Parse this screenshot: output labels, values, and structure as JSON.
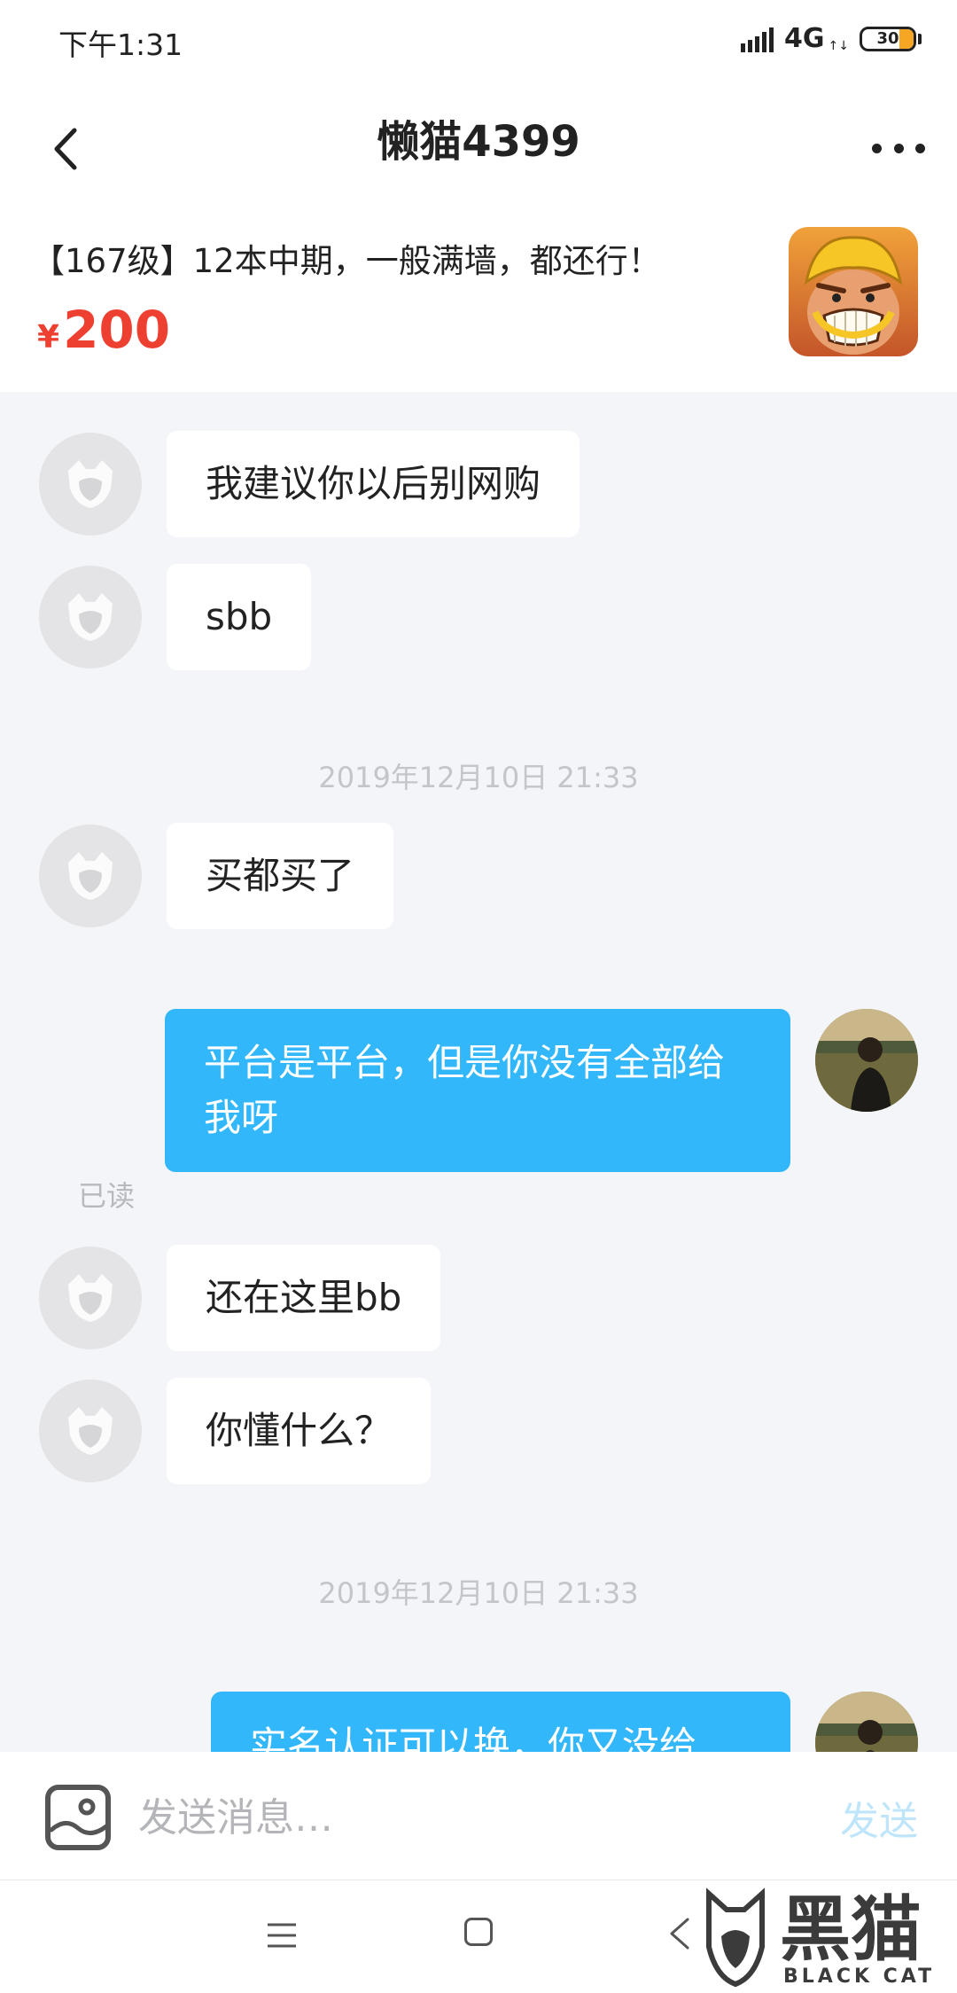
{
  "status_bar": {
    "time": "下午1:31",
    "network": "4G",
    "battery": "30"
  },
  "header": {
    "title": "懒猫4399",
    "back_icon": "chevron-left-icon",
    "more_icon": "more-dots-icon"
  },
  "product": {
    "title": "【167级】12本中期，一般满墙，都还行！",
    "price_symbol": "¥",
    "price": "200",
    "icon": "clash-of-clans-icon"
  },
  "messages": [
    {
      "side": "in",
      "text": "我建议你以后别网购"
    },
    {
      "side": "in",
      "text": "sbb"
    },
    {
      "type": "timestamp",
      "text": "2019年12月10日 21:33"
    },
    {
      "side": "in",
      "text": "买都买了"
    },
    {
      "side": "out",
      "text": "平台是平台，但是你没有全部给我呀",
      "status": "已读"
    },
    {
      "side": "in",
      "text": "还在这里bb"
    },
    {
      "side": "in",
      "text": "你懂什么？"
    },
    {
      "type": "timestamp",
      "text": "2019年12月10日 21:33"
    },
    {
      "side": "out",
      "text": "实名认证可以换，你又没给"
    }
  ],
  "input": {
    "placeholder": "发送消息…",
    "send_label": "发送",
    "image_icon": "image-icon"
  },
  "navigation": {
    "menu_icon": "menu-icon",
    "home_icon": "home-square-icon",
    "back_icon": "back-triangle-icon"
  },
  "watermark": {
    "text": "黑猫",
    "sub": "BLACK CAT"
  },
  "colors": {
    "accent_blue": "#33b7fb",
    "price_red": "#ee4030",
    "chat_bg": "#f4f5f9"
  }
}
